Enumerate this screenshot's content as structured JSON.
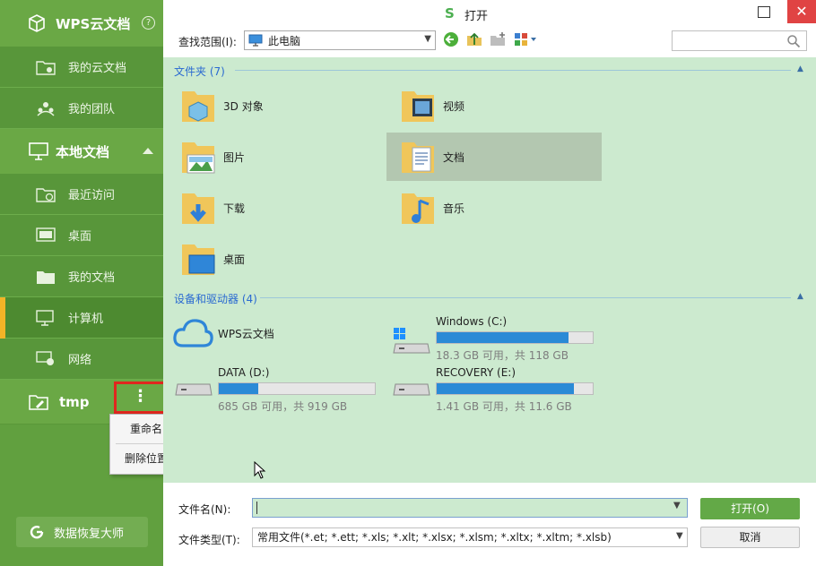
{
  "sidebar": {
    "app_name": "WPS云文档",
    "help": "?",
    "cloud_items": [
      {
        "label": "我的云文档",
        "icon": "cloud-folder-icon"
      },
      {
        "label": "我的团队",
        "icon": "team-icon"
      }
    ],
    "local_section": "本地文档",
    "local_items": [
      {
        "label": "最近访问",
        "icon": "recent-folder-icon"
      },
      {
        "label": "桌面",
        "icon": "desktop-icon"
      },
      {
        "label": "我的文档",
        "icon": "folder-icon"
      },
      {
        "label": "计算机",
        "icon": "computer-icon"
      },
      {
        "label": "网络",
        "icon": "network-icon"
      }
    ],
    "tmp_label": "tmp",
    "more": "⋮",
    "context_menu": [
      "重命名",
      "删除位置"
    ],
    "recover_label": "数据恢复大师"
  },
  "window": {
    "title": "打开",
    "logo": "S",
    "close": "✕"
  },
  "toolbar": {
    "scope_label": "查找范围(I):",
    "scope_value": "此电脑"
  },
  "groups": {
    "folders_header": "文件夹 (7)",
    "drives_header": "设备和驱动器 (4)"
  },
  "folders": [
    {
      "name": "3D 对象"
    },
    {
      "name": "视频"
    },
    {
      "name": "图片"
    },
    {
      "name": "文档"
    },
    {
      "name": "下载"
    },
    {
      "name": "音乐"
    },
    {
      "name": "桌面"
    }
  ],
  "drives": [
    {
      "name": "WPS云文档"
    },
    {
      "name": "Windows (C:)",
      "info": "18.3 GB 可用，共 118 GB",
      "used_fraction": 0.845
    },
    {
      "name": "DATA (D:)",
      "info": "685 GB 可用，共 919 GB",
      "used_fraction": 0.255
    },
    {
      "name": "RECOVERY (E:)",
      "info": "1.41 GB 可用，共 11.6 GB",
      "used_fraction": 0.878
    }
  ],
  "bottom": {
    "filename_label": "文件名(N):",
    "filetype_label": "文件类型(T):",
    "filetype_value": "常用文件(*.et; *.ett; *.xls; *.xlt; *.xlsx; *.xlsm; *.xltx; *.xltm; *.xlsb)",
    "open_label": "打开(O)",
    "cancel_label": "取消"
  },
  "colors": {
    "sidebar": "#61a03f",
    "content_bg": "#cceacf",
    "accent_blue": "#2a8ad6",
    "highlight_red": "#e0261e"
  }
}
